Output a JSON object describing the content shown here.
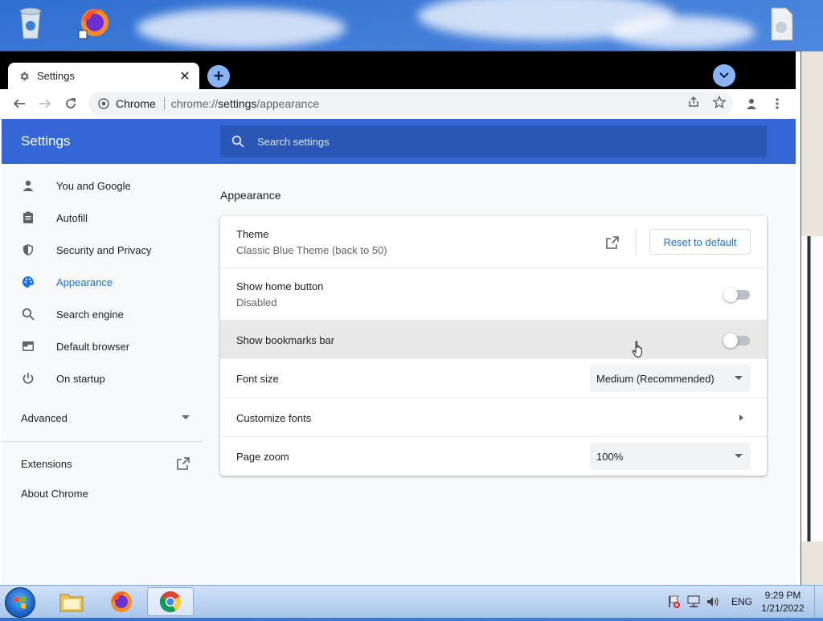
{
  "browser": {
    "tab_title": "Settings",
    "omnibox": {
      "chip": "Chrome",
      "url_scheme": "chrome://",
      "url_host": "settings",
      "url_path": "/appearance"
    }
  },
  "settings": {
    "header_title": "Settings",
    "search_placeholder": "Search settings",
    "sidebar": {
      "items": [
        {
          "label": "You and Google",
          "icon": "person-icon"
        },
        {
          "label": "Autofill",
          "icon": "clipboard-icon"
        },
        {
          "label": "Security and Privacy",
          "icon": "shield-icon"
        },
        {
          "label": "Appearance",
          "icon": "palette-icon",
          "active": true
        },
        {
          "label": "Search engine",
          "icon": "search-icon"
        },
        {
          "label": "Default browser",
          "icon": "browser-window-icon"
        },
        {
          "label": "On startup",
          "icon": "power-icon"
        }
      ],
      "advanced": "Advanced",
      "extensions": "Extensions",
      "about": "About Chrome"
    },
    "section_title": "Appearance",
    "rows": {
      "theme": {
        "label": "Theme",
        "value": "Classic Blue Theme (back to 50)",
        "reset": "Reset to default"
      },
      "home_button": {
        "label": "Show home button",
        "value": "Disabled",
        "enabled": false
      },
      "bookmarks_bar": {
        "label": "Show bookmarks bar",
        "enabled": false
      },
      "font_size": {
        "label": "Font size",
        "value": "Medium (Recommended)"
      },
      "customize_fonts": {
        "label": "Customize fonts"
      },
      "page_zoom": {
        "label": "Page zoom",
        "value": "100%"
      }
    }
  },
  "taskbar": {
    "language": "ENG",
    "time": "9:29 PM",
    "date": "1/21/2022"
  },
  "colors": {
    "accent": "#1a73e8",
    "header": "#3367d6",
    "header_search": "#2a56b5"
  }
}
